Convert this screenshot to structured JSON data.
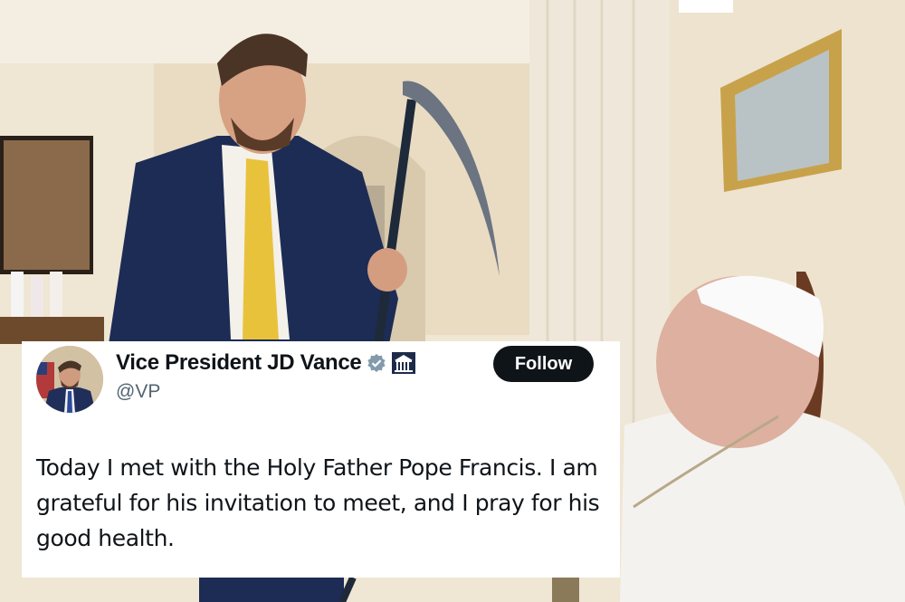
{
  "post": {
    "display_name": "Vice President JD Vance",
    "handle": "@VP",
    "follow_label": "Follow",
    "text": "Today I met with the Holy Father Pope Francis. I am grateful for his invitation to meet, and I pray for his good health.",
    "verified_icon": "verified-badge-icon",
    "affiliation_icon": "white-house-icon"
  },
  "colors": {
    "card_bg": "#ffffff",
    "follow_bg": "#0f1419",
    "name_text": "#0f1419",
    "handle_text": "#536471",
    "badge_gray": "#829aab"
  }
}
